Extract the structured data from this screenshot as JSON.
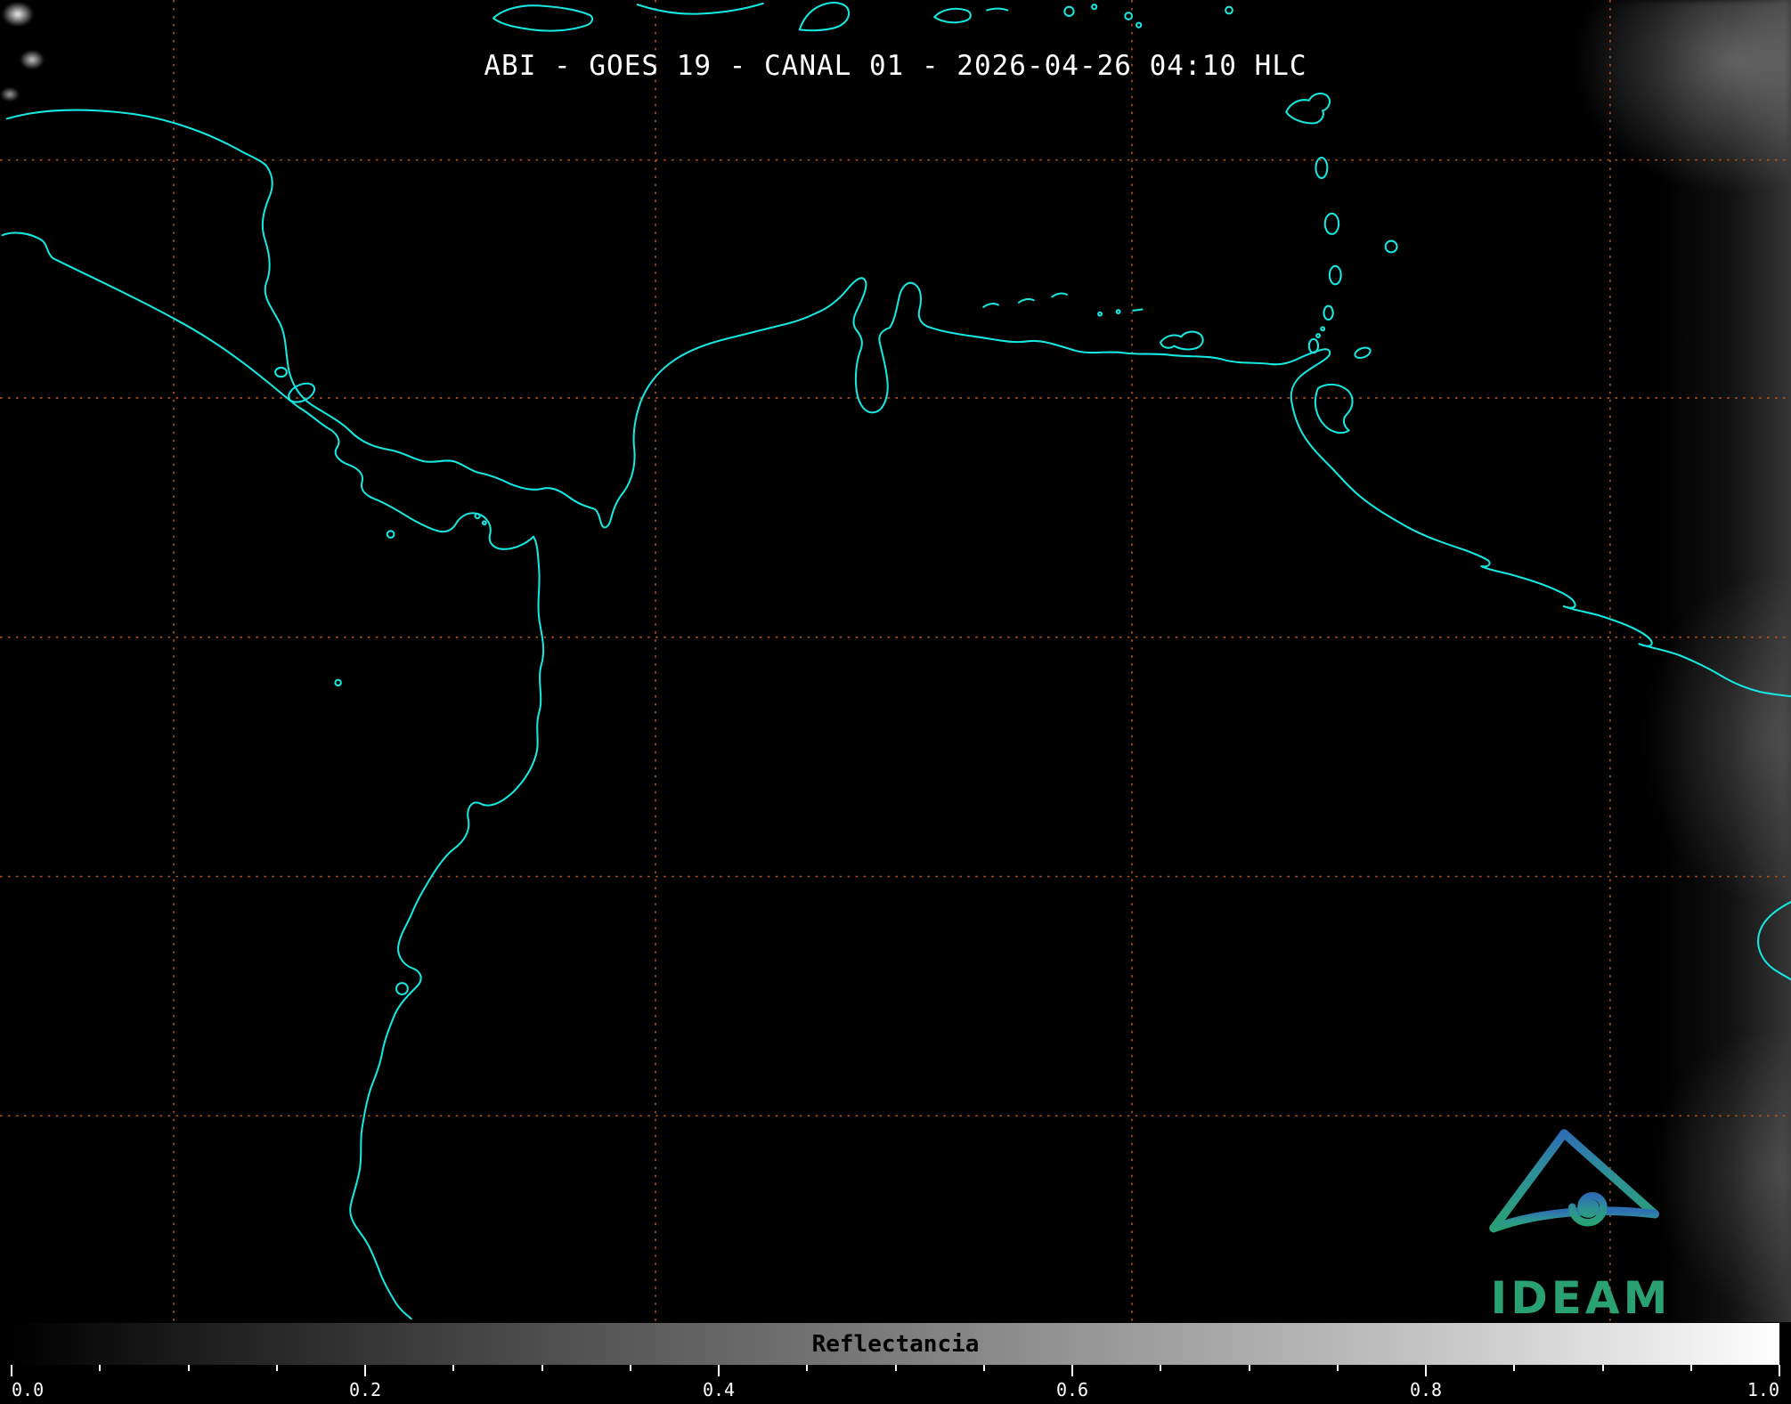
{
  "product": {
    "title": "ABI - GOES 19 - CANAL 01 - 2026-04-26 04:10 HLC",
    "instrument": "ABI",
    "satellite": "GOES 19",
    "channel": "CANAL 01",
    "datetime": "2026-04-26 04:10 HLC"
  },
  "map": {
    "graticule": {
      "vertical_fractions": [
        0.097,
        0.366,
        0.632,
        0.899
      ],
      "horizontal_fractions": [
        0.121,
        0.301,
        0.482,
        0.663,
        0.844
      ]
    }
  },
  "colorbar": {
    "label": "Reflectancia",
    "min": 0.0,
    "max": 1.0,
    "tick_labels": [
      "0.0",
      "0.2",
      "0.4",
      "0.6",
      "0.8",
      "1.0"
    ]
  },
  "logo": {
    "text": "IDEAM"
  },
  "colors": {
    "background": "#000000",
    "coast": "#15e8e0",
    "grid": "#b8541e",
    "title-color": "#ffffff",
    "bar-label-color": "#000000",
    "tick-color": "#ffffff",
    "logo-blue": "#2e6fb4",
    "logo-teal": "#2e9196",
    "logo-green": "#2aa173"
  }
}
